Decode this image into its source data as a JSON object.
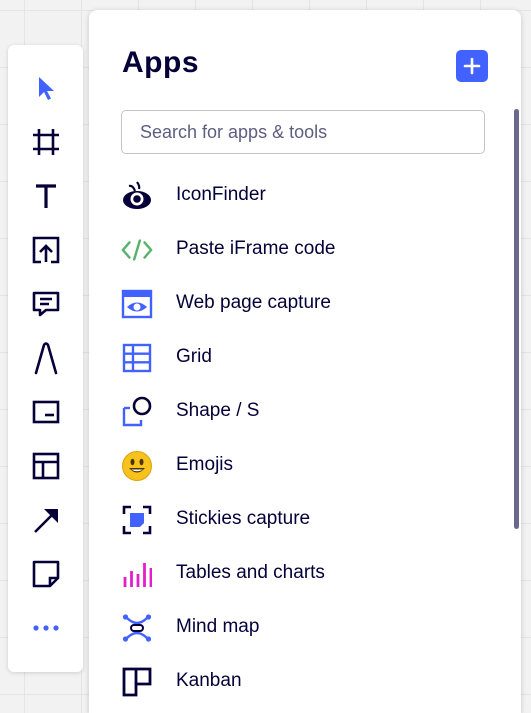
{
  "toolbar": {
    "tools": [
      {
        "name": "select"
      },
      {
        "name": "frame"
      },
      {
        "name": "text"
      },
      {
        "name": "upload"
      },
      {
        "name": "comment"
      },
      {
        "name": "pen"
      },
      {
        "name": "card"
      },
      {
        "name": "templates"
      },
      {
        "name": "arrow"
      },
      {
        "name": "sticky-note"
      },
      {
        "name": "more"
      }
    ],
    "accent_color": "#4262ff"
  },
  "panel": {
    "title": "Apps",
    "search_placeholder": "Search for apps & tools",
    "apps": [
      {
        "label": "IconFinder",
        "icon": "iconfinder-icon"
      },
      {
        "label": "Paste iFrame code",
        "icon": "code-icon"
      },
      {
        "label": "Web page capture",
        "icon": "web-capture-icon"
      },
      {
        "label": "Grid",
        "icon": "grid-icon"
      },
      {
        "label": "Shape / S",
        "icon": "shape-icon"
      },
      {
        "label": "Emojis",
        "icon": "emoji-icon"
      },
      {
        "label": "Stickies capture",
        "icon": "stickies-capture-icon"
      },
      {
        "label": "Tables and charts",
        "icon": "chart-icon"
      },
      {
        "label": "Mind map",
        "icon": "mind-map-icon"
      },
      {
        "label": "Kanban",
        "icon": "kanban-icon"
      }
    ]
  }
}
